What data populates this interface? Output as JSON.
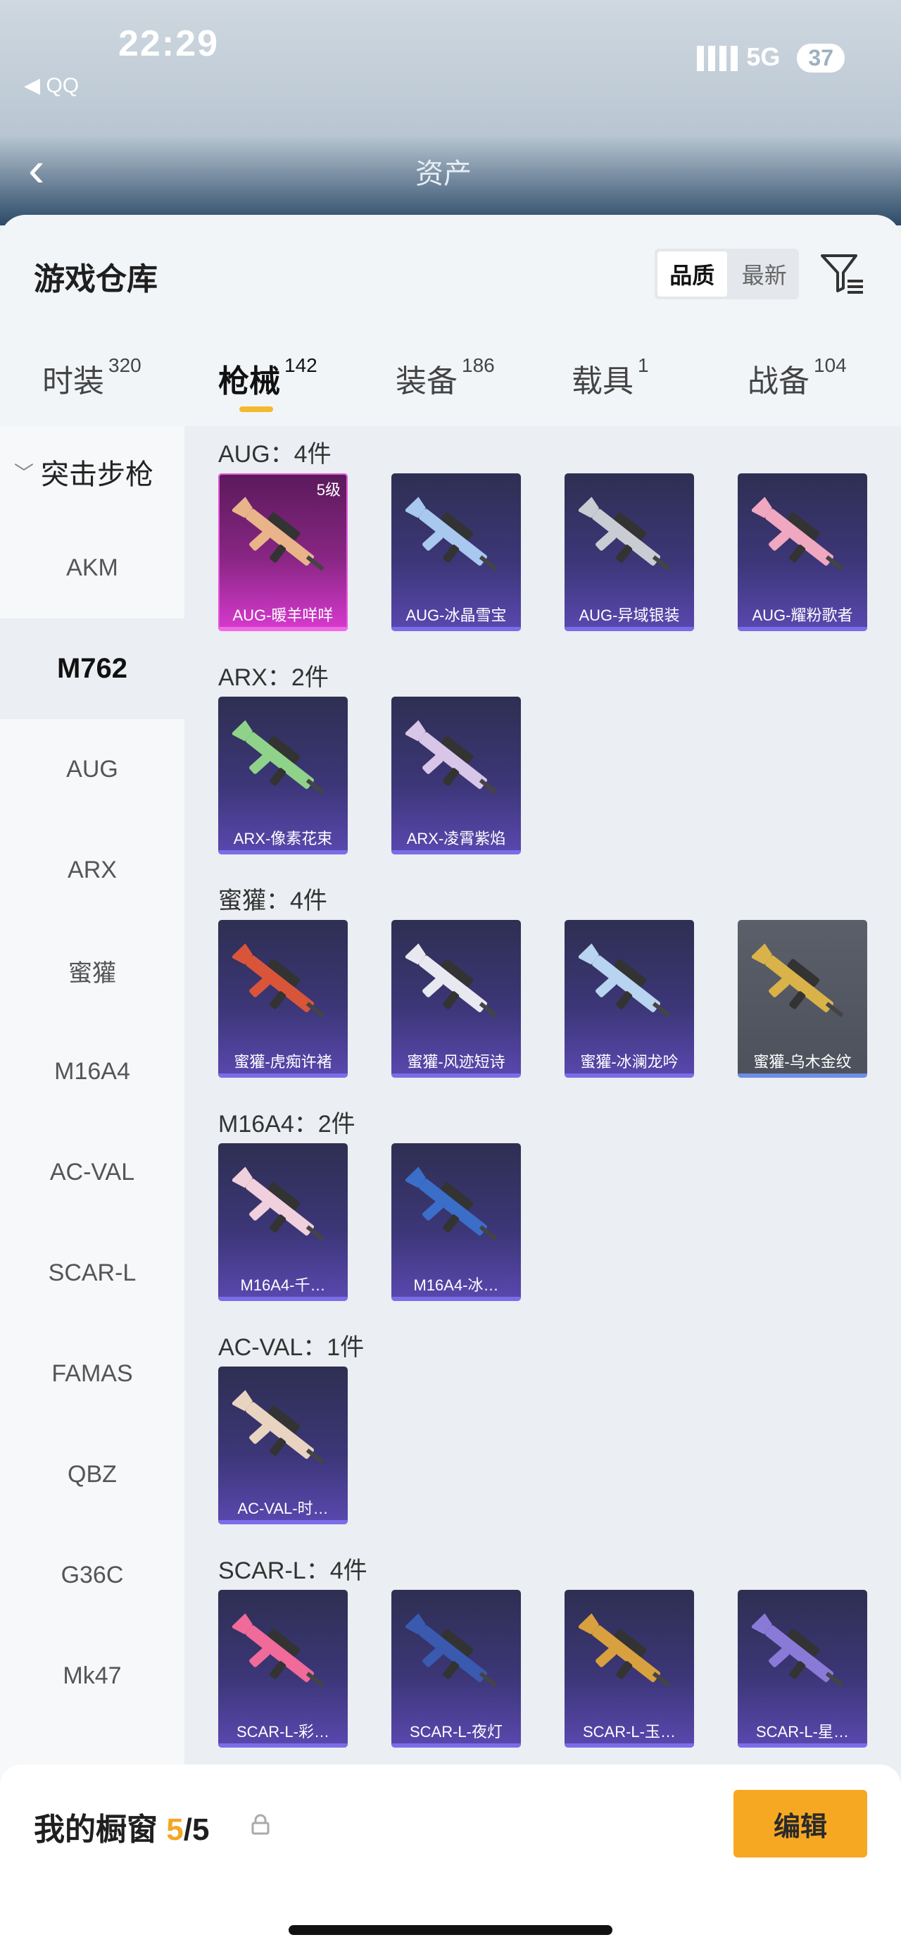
{
  "status": {
    "time": "22:29",
    "network": "5G",
    "battery": "37",
    "back_app": "◀ QQ"
  },
  "header": {
    "back": "‹",
    "title": "资产"
  },
  "sheet": {
    "title": "游戏仓库",
    "sort": {
      "options": [
        "品质",
        "最新"
      ],
      "active": "品质"
    },
    "filter_icon": "filter-icon"
  },
  "tabs": [
    {
      "label": "时装",
      "count": "320"
    },
    {
      "label": "枪械",
      "count": "142",
      "active": true
    },
    {
      "label": "装备",
      "count": "186"
    },
    {
      "label": "载具",
      "count": "1"
    },
    {
      "label": "战备",
      "count": "104"
    }
  ],
  "sidebar": {
    "section": "突击步枪",
    "items": [
      "AKM",
      "M762",
      "AUG",
      "ARX",
      "蜜獾",
      "M16A4",
      "AC-VAL",
      "SCAR-L",
      "FAMAS",
      "QBZ",
      "G36C",
      "Mk47"
    ],
    "active": "M762"
  },
  "groups": [
    {
      "title": "AUG：4件",
      "items": [
        {
          "label": "AUG-暖羊咩咩",
          "level": "5级",
          "style": "rare",
          "color": "#e9b48a"
        },
        {
          "label": "AUG-冰晶雪宝",
          "style": "epic",
          "color": "#a8c8f0"
        },
        {
          "label": "AUG-异域银装",
          "style": "epic",
          "color": "#c9ccd2"
        },
        {
          "label": "AUG-耀粉歌者",
          "style": "epic",
          "color": "#f0a8c0"
        }
      ]
    },
    {
      "title": "ARX：2件",
      "items": [
        {
          "label": "ARX-像素花束",
          "style": "epic",
          "color": "#8fd38a"
        },
        {
          "label": "ARX-凌霄紫焰",
          "style": "epic",
          "color": "#d8c6e8"
        }
      ]
    },
    {
      "title": "蜜獾：4件",
      "items": [
        {
          "label": "蜜獾-虎痴许褚",
          "style": "epic",
          "color": "#d9553a"
        },
        {
          "label": "蜜獾-风迹短诗",
          "style": "epic",
          "color": "#e8e8f0"
        },
        {
          "label": "蜜獾-冰澜龙吟",
          "style": "epic",
          "color": "#b8d4f0"
        },
        {
          "label": "蜜獾-乌木金纹",
          "style": "gray",
          "color": "#d9b24a"
        }
      ]
    },
    {
      "title": "M16A4：2件",
      "items": [
        {
          "label": "M16A4-千…",
          "style": "epic",
          "color": "#f0d0dc"
        },
        {
          "label": "M16A4-冰…",
          "style": "epic",
          "color": "#3a6ec8"
        }
      ]
    },
    {
      "title": "AC-VAL：1件",
      "items": [
        {
          "label": "AC-VAL-时…",
          "style": "epic",
          "color": "#e8d4c0"
        }
      ]
    },
    {
      "title": "SCAR-L：4件",
      "items": [
        {
          "label": "SCAR-L-彩…",
          "style": "epic",
          "color": "#f06a9a"
        },
        {
          "label": "SCAR-L-夜灯",
          "style": "epic",
          "color": "#3a5ab0"
        },
        {
          "label": "SCAR-L-玉…",
          "style": "epic",
          "color": "#d9a040"
        },
        {
          "label": "SCAR-L-星…",
          "style": "epic",
          "color": "#8a7ad8"
        }
      ]
    }
  ],
  "fab_icon": "share-icon",
  "bottom": {
    "title": "我的橱窗",
    "current": "5",
    "separator": "/",
    "total": "5",
    "edit_label": "编辑"
  }
}
